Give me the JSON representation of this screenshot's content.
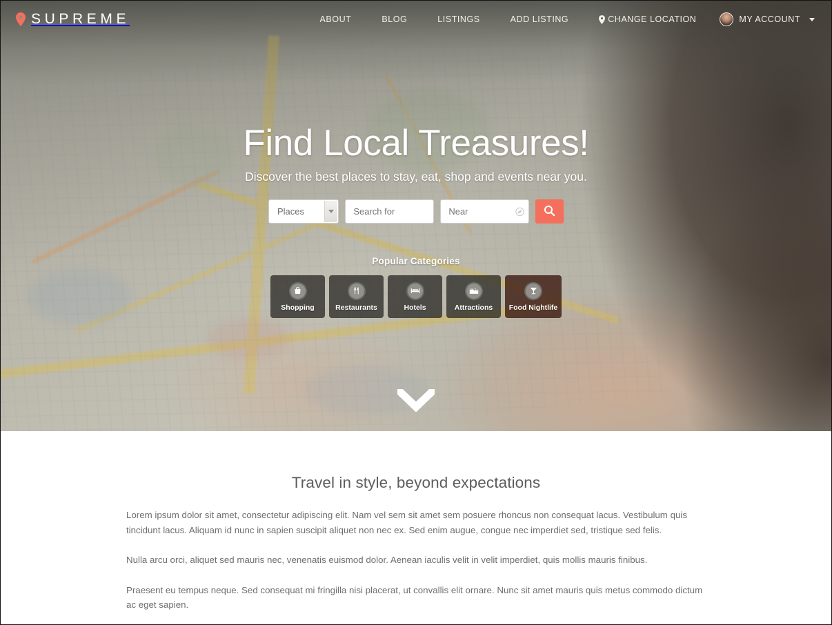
{
  "brand": {
    "name": "SUPREME",
    "pin_icon": "map-pin-icon",
    "accent_color": "#f4705c"
  },
  "nav": {
    "items": [
      {
        "label": "ABOUT"
      },
      {
        "label": "BLOG"
      },
      {
        "label": "LISTINGS"
      },
      {
        "label": "ADD LISTING"
      },
      {
        "label": "CHANGE LOCATION",
        "icon": "map-pin-icon"
      }
    ],
    "account": {
      "label": "MY ACCOUNT",
      "avatar_icon": "user-avatar-icon",
      "caret_icon": "chevron-down-icon"
    }
  },
  "hero": {
    "title": "Find Local Treasures!",
    "subtitle": "Discover the best places to stay, eat, shop and events near you.",
    "search": {
      "category_value": "Places",
      "category_caret_icon": "chevron-down-icon",
      "keyword_placeholder": "Search for",
      "keyword_value": "",
      "near_placeholder": "Near",
      "near_value": "",
      "locate_icon": "locate-me-icon",
      "submit_icon": "search-icon"
    },
    "categories_title": "Popular Categories",
    "categories": [
      {
        "label": "Shopping",
        "icon": "shopping-bag-icon"
      },
      {
        "label": "Restaurants",
        "icon": "fork-knife-icon"
      },
      {
        "label": "Hotels",
        "icon": "bed-icon"
      },
      {
        "label": "Attractions",
        "icon": "castle-icon"
      },
      {
        "label": "Food Nightlife",
        "icon": "cocktail-glass-icon"
      }
    ],
    "scroll_icon": "chevron-down-icon"
  },
  "about": {
    "heading": "Travel in style, beyond expectations",
    "paragraphs": [
      "Lorem ipsum dolor sit amet, consectetur adipiscing elit. Nam vel sem sit amet sem posuere rhoncus non consequat lacus. Vestibulum quis tincidunt lacus. Aliquam id nunc in sapien suscipit aliquet non nec ex. Sed enim augue, congue nec imperdiet sed, tristique sed felis.",
      "Nulla arcu orci, aliquet sed mauris nec, venenatis euismod dolor. Aenean iaculis velit in velit imperdiet, quis mollis mauris finibus.",
      "Praesent eu tempus neque. Sed consequat mi fringilla nisi placerat, ut convallis elit ornare. Nunc sit amet mauris quis metus commodo dictum ac eget sapien."
    ]
  }
}
